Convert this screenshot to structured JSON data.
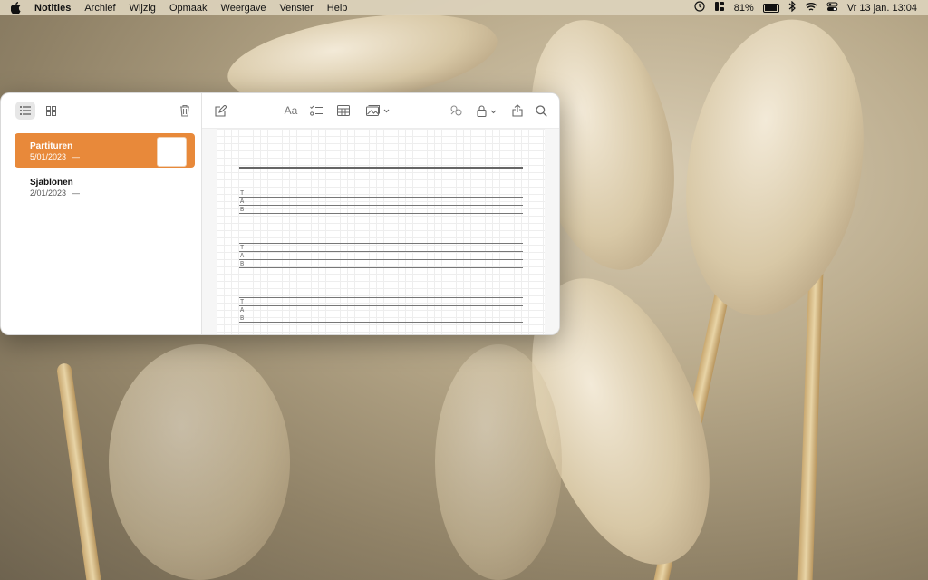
{
  "menubar": {
    "app_name": "Notities",
    "items": [
      "Archief",
      "Wijzig",
      "Opmaak",
      "Weergave",
      "Venster",
      "Help"
    ],
    "battery": "81%",
    "datetime": "Vr 13 jan.  13:04"
  },
  "sidebar": {
    "notes": [
      {
        "title": "Partituren",
        "date": "5/01/2023",
        "snippet": "—",
        "selected": true
      },
      {
        "title": "Sjablonen",
        "date": "2/01/2023",
        "snippet": "—",
        "selected": false
      }
    ]
  },
  "editor": {
    "format_label": "Aa",
    "tab_labels": [
      "T",
      "A",
      "B"
    ]
  },
  "colors": {
    "accent": "#e8893a"
  }
}
